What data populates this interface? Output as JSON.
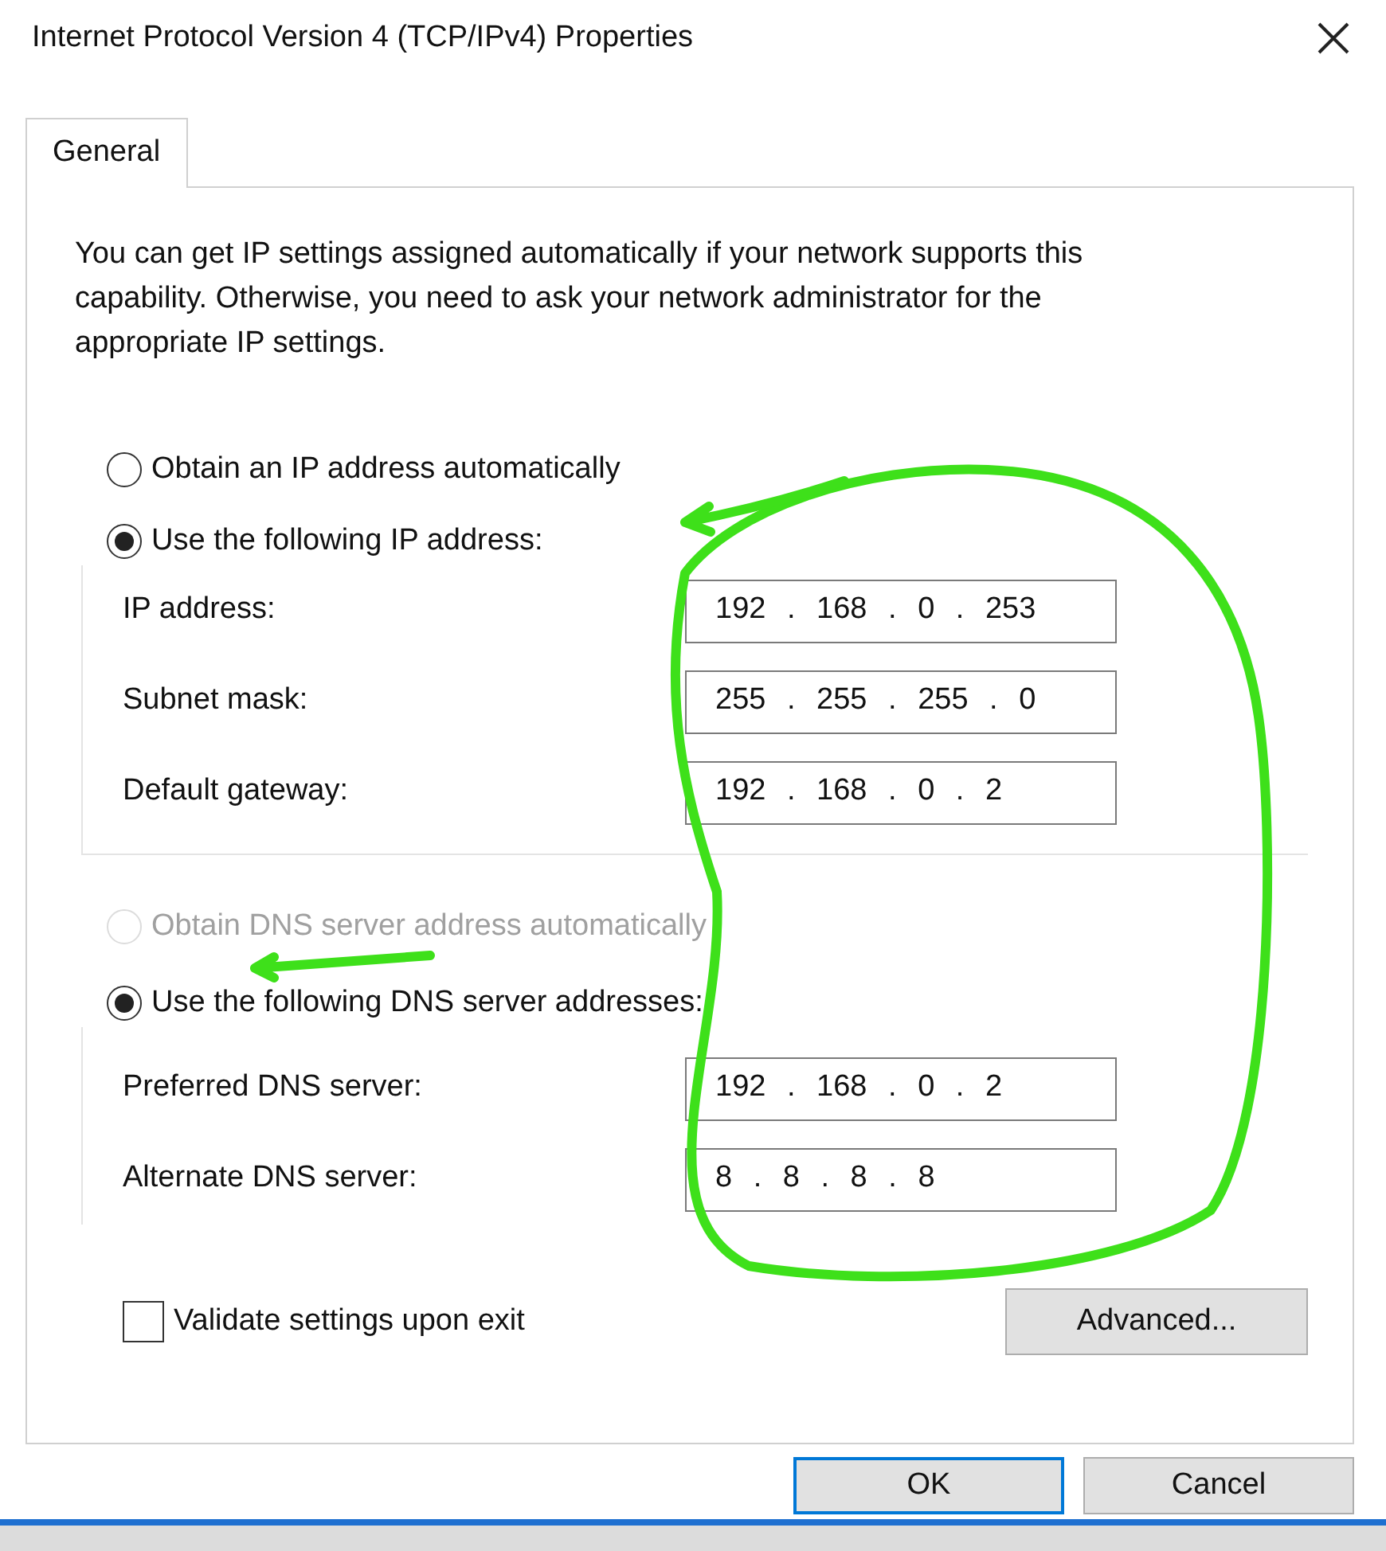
{
  "window": {
    "title": "Internet Protocol Version 4 (TCP/IPv4) Properties"
  },
  "tabs": [
    {
      "label": "General",
      "selected": true
    }
  ],
  "description": "You can get IP settings assigned automatically if your network supports this capability. Otherwise, you need to ask your network administrator for the appropriate IP settings.",
  "ip_options": [
    {
      "label": "Obtain an IP address automatically",
      "selected": false,
      "disabled": false
    },
    {
      "label": "Use the following IP address:",
      "selected": true,
      "disabled": false
    }
  ],
  "ip_fields": [
    {
      "label": "IP address:",
      "value": "192 . 168 . 0 . 253"
    },
    {
      "label": "Subnet mask:",
      "value": "255 . 255 . 255 . 0"
    },
    {
      "label": "Default gateway:",
      "value": "192 . 168 . 0 . 2"
    }
  ],
  "dns_options": [
    {
      "label": "Obtain DNS server address automatically",
      "selected": false,
      "disabled": true
    },
    {
      "label": "Use the following DNS server addresses:",
      "selected": true,
      "disabled": false
    }
  ],
  "dns_fields": [
    {
      "label": "Preferred DNS server:",
      "value": "192 . 168 . 0 . 2"
    },
    {
      "label": "Alternate DNS server:",
      "value": "8 . 8 . 8 . 8"
    }
  ],
  "validate": {
    "label": "Validate settings upon exit",
    "checked": false
  },
  "advanced_button": "Advanced...",
  "buttons": [
    {
      "label": "OK",
      "default": true
    },
    {
      "label": "Cancel",
      "default": false
    }
  ]
}
